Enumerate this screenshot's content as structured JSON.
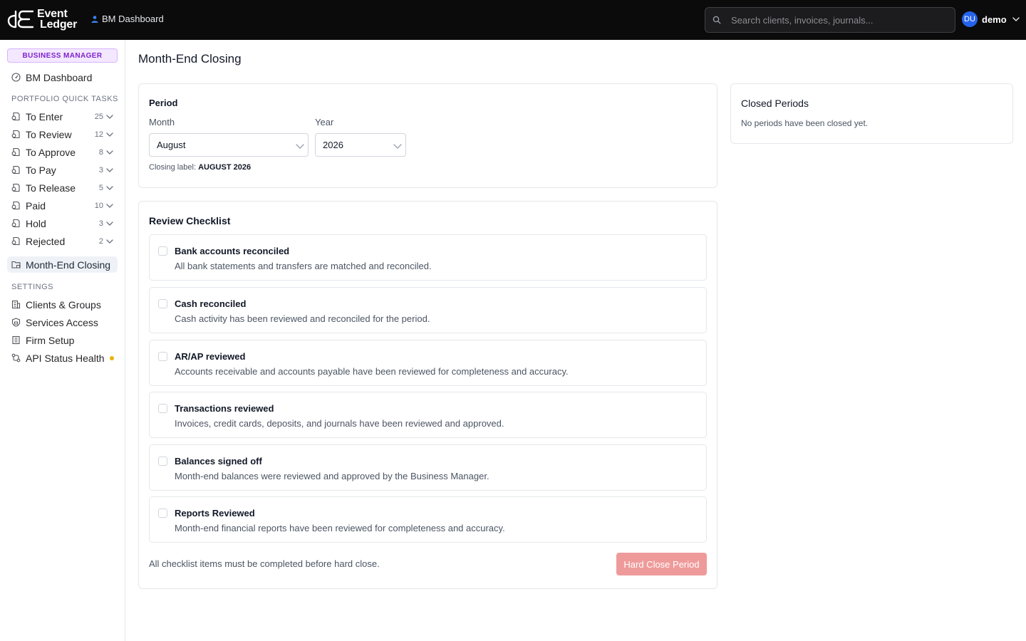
{
  "header": {
    "logo_line1": "Event",
    "logo_line2": "Ledger",
    "breadcrumb": "BM Dashboard",
    "search_placeholder": "Search clients, invoices, journals...",
    "user_initials": "DU",
    "user_name": "demo"
  },
  "sidebar": {
    "badge": "BUSINESS MANAGER",
    "dashboard": "BM Dashboard",
    "quick_tasks_label": "PORTFOLIO QUICK TASKS",
    "tasks": [
      {
        "label": "To Enter",
        "count": "25"
      },
      {
        "label": "To Review",
        "count": "12"
      },
      {
        "label": "To Approve",
        "count": "8"
      },
      {
        "label": "To Pay",
        "count": "3"
      },
      {
        "label": "To Release",
        "count": "5"
      },
      {
        "label": "Paid",
        "count": "10"
      },
      {
        "label": "Hold",
        "count": "3"
      },
      {
        "label": "Rejected",
        "count": "2"
      }
    ],
    "month_end": "Month-End Closing",
    "settings_label": "SETTINGS",
    "settings": [
      {
        "label": "Clients & Groups"
      },
      {
        "label": "Services Access"
      },
      {
        "label": "Firm Setup"
      },
      {
        "label": "API Status Health"
      }
    ]
  },
  "main": {
    "title": "Month-End Closing",
    "period": {
      "title": "Period",
      "month_label": "Month",
      "month_value": "August",
      "year_label": "Year",
      "year_value": "2026",
      "closing_label_prefix": "Closing label:",
      "closing_label_value": "AUGUST 2026"
    },
    "checklist": {
      "title": "Review Checklist",
      "items": [
        {
          "title": "Bank accounts reconciled",
          "desc": "All bank statements and transfers are matched and reconciled."
        },
        {
          "title": "Cash reconciled",
          "desc": "Cash activity has been reviewed and reconciled for the period."
        },
        {
          "title": "AR/AP reviewed",
          "desc": "Accounts receivable and accounts payable have been reviewed for completeness and accuracy."
        },
        {
          "title": "Transactions reviewed",
          "desc": "Invoices, credit cards, deposits, and journals have been reviewed and approved."
        },
        {
          "title": "Balances signed off",
          "desc": "Month-end balances were reviewed and approved by the Business Manager."
        },
        {
          "title": "Reports Reviewed",
          "desc": "Month-end financial reports have been reviewed for completeness and accuracy."
        }
      ],
      "footer_note": "All checklist items must be completed before hard close.",
      "hard_close_label": "Hard Close Period"
    },
    "closed_periods": {
      "title": "Closed Periods",
      "empty": "No periods have been closed yet."
    }
  },
  "colors": {
    "accent_purple": "#7e22ce",
    "avatar_blue": "#2563eb",
    "hard_close_disabled": "#ef9a9a",
    "status_warning": "#eab308"
  }
}
